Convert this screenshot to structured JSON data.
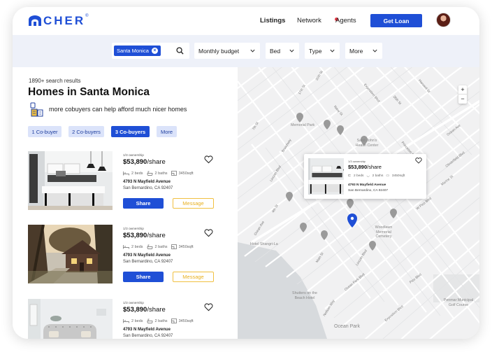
{
  "brand": {
    "name": "CHER",
    "mark": "®"
  },
  "nav": {
    "listings": "Listings",
    "network": "Network",
    "agents": "Agents",
    "cta": "Get Loan"
  },
  "filters": {
    "chip": "Santa Monica",
    "dropdowns": [
      "Monthly budget",
      "Bed",
      "Type",
      "More"
    ]
  },
  "results": {
    "count": "1890+ search results",
    "title": "Homes in Santa Monica",
    "promo": "more cobuyers can help afford much nicer homes",
    "cobuyer_options": [
      "1 Co-buyer",
      "2 Co-buyers",
      "3 Co-buyers",
      "More"
    ],
    "selected_option": "3 Co-buyers"
  },
  "listings": [
    {
      "ownership": "1/3 ownership",
      "price": "$53,890",
      "unit": "/share",
      "beds": "2 beds",
      "baths": "2 baths",
      "sqft": "3450sqft",
      "address": "4793 N Mayfield Avenue",
      "city": "San Bernardino, CA 92407",
      "share": "Share",
      "message": "Message"
    },
    {
      "ownership": "1/3 ownership",
      "price": "$53,890",
      "unit": "/share",
      "beds": "2 beds",
      "baths": "2 baths",
      "sqft": "3450sqft",
      "address": "4793 N Mayfield Avenue",
      "city": "San Bernardino, CA 92407",
      "share": "Share",
      "message": "Message"
    },
    {
      "ownership": "1/3 ownership",
      "price": "$53,890",
      "unit": "/share",
      "beds": "2 beds",
      "baths": "2 baths",
      "sqft": "3450sqft",
      "address": "4793 N Mayfield Avenue",
      "city": "San Bernardino, CA 92407",
      "share": "Share",
      "message": "Message"
    }
  ],
  "map_popup": {
    "ownership": "1/3 ownership",
    "price": "$53,890",
    "unit": "/share",
    "beds": "2 beds",
    "baths": "2 baths",
    "sqft": "3450sqft",
    "address": "4793 N Mayfield Avenue",
    "city": "San Bernardino, CA 92407"
  },
  "map": {
    "zoom_in": "+",
    "zoom_out": "−",
    "places": [
      "Memorial Park",
      "Saint John's Health Center",
      "Woodlawn Memorial Cemetery",
      "Hotel Shangri-La",
      "Shutters on the Beach Hotel",
      "Ocean Park",
      "Penmar Municipal Golf Course"
    ],
    "streets": [
      "Lincoln Blvd",
      "Pico Blvd",
      "Ocean Park Blvd",
      "W Pico Blvd",
      "Colorado Ave",
      "Broadway",
      "Wilshire Blvd",
      "Arizona Ave",
      "Santa Monica Blvd",
      "Olympic Blvd",
      "Expo Line",
      "20th St",
      "Cloverfield Blvd",
      "17th St",
      "14th St",
      "11th St",
      "Euclid St",
      "7th St",
      "6th St",
      "4th St",
      "Main St",
      "Neilson Way",
      "Ocean Ave",
      "Rose Ave",
      "Marine St",
      "Navy St",
      "Exposition Blvd",
      "Stewart St",
      "26th St",
      "Princeton St",
      "Harvard St",
      "Berkeley St",
      "Franklin St",
      "Yale St",
      "Centinela Ave",
      "Bundy Dr",
      "Barnard Way"
    ]
  },
  "colors": {
    "brand": "#1f4fd6",
    "accent": "#f0c040",
    "chip_bg": "#dbe3fa",
    "filter_bg": "#eef1f9",
    "map_bg": "#f1f1f2",
    "ocean": "#d7dadd",
    "pin_active": "#1f4fd6",
    "pin": "#9a9a9a"
  },
  "icons": {
    "search": "search-icon",
    "chevron": "chevron-down-icon",
    "heart": "heart-icon",
    "bed": "bed-icon",
    "bath": "bath-icon",
    "area": "area-icon",
    "pin": "map-pin-icon",
    "cobuyer": "cobuyer-icon"
  }
}
